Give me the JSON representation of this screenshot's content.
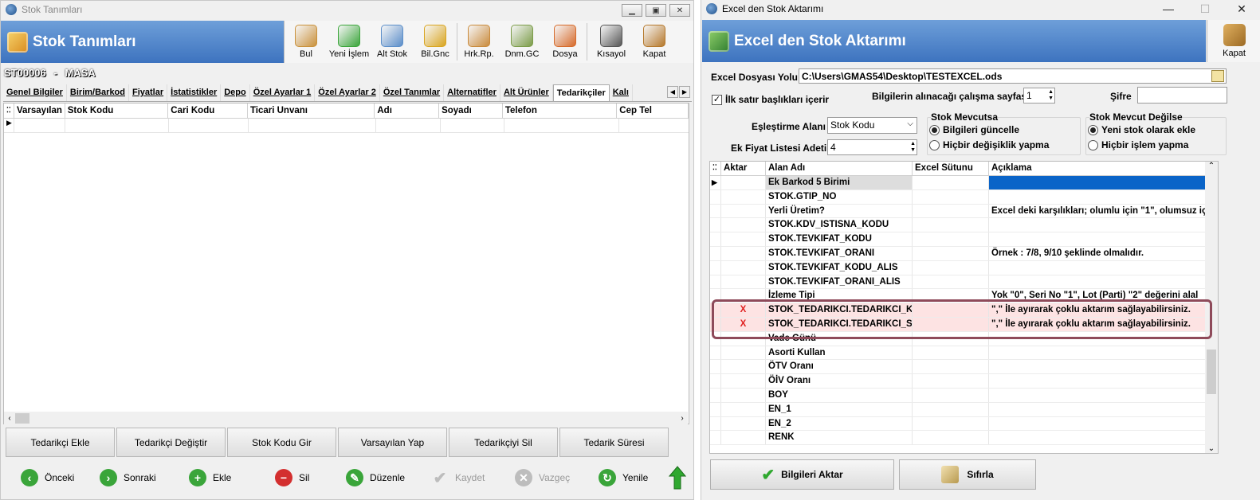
{
  "left_window": {
    "title": "Stok Tanımları",
    "banner_title": "Stok Tanımları",
    "toolbar": [
      {
        "label": "Bul",
        "icon": "find-icon",
        "color": "#c9913b"
      },
      {
        "label": "Yeni İşlem",
        "icon": "new-icon",
        "color": "#3aa53a"
      },
      {
        "label": "Alt Stok",
        "icon": "substock-icon",
        "color": "#5b8ec9"
      },
      {
        "label": "Bil.Gnc",
        "icon": "update-icon",
        "color": "#d9a520"
      },
      {
        "label": "Hrk.Rp.",
        "icon": "report-icon",
        "color": "#c98a3b"
      },
      {
        "label": "Dnm.GC",
        "icon": "period-icon",
        "color": "#7b9c48"
      },
      {
        "label": "Dosya",
        "icon": "file-icon",
        "color": "#d66a2a"
      },
      {
        "label": "Kısayol",
        "icon": "keyboard-icon",
        "color": "#555555"
      },
      {
        "label": "Kapat",
        "icon": "close-door-icon",
        "color": "#b5782b"
      }
    ],
    "record_code": "ST00006",
    "record_sep": "-",
    "record_name": "MASA",
    "tabs": [
      "Genel Bilgiler",
      "Birim/Barkod",
      "Fiyatlar",
      "İstatistikler",
      "Depo",
      "Özel Ayarlar 1",
      "Özel Ayarlar 2",
      "Özel Tanımlar",
      "Alternatifler",
      "Alt Ürünler",
      "Tedarikçiler",
      "Kalı"
    ],
    "active_tab": "Tedarikçiler",
    "grid_columns": [
      "Varsayılan",
      "Stok Kodu",
      "Cari Kodu",
      "Ticari Unvanı",
      "Adı",
      "Soyadı",
      "Telefon",
      "Cep Tel"
    ],
    "action_buttons": [
      "Tedarikçi Ekle",
      "Tedarikçi Değiştir",
      "Stok Kodu Gir",
      "Varsayılan Yap",
      "Tedarikçiyi Sil",
      "Tedarik Süresi"
    ],
    "nav_buttons": [
      {
        "label": "Önceki",
        "icon": "back-arrow-icon",
        "color": "#3aa53a",
        "enabled": true
      },
      {
        "label": "Sonraki",
        "icon": "forward-arrow-icon",
        "color": "#3aa53a",
        "enabled": true
      },
      {
        "label": "Ekle",
        "icon": "add-icon",
        "color": "#3aa53a",
        "enabled": true
      },
      {
        "label": "Sil",
        "icon": "delete-icon",
        "color": "#d32f2f",
        "enabled": true
      },
      {
        "label": "Düzenle",
        "icon": "edit-icon",
        "color": "#3aa53a",
        "enabled": true
      },
      {
        "label": "Kaydet",
        "icon": "save-check-icon",
        "color": "#bdbdbd",
        "enabled": false
      },
      {
        "label": "Vazgeç",
        "icon": "cancel-icon",
        "color": "#bdbdbd",
        "enabled": false
      },
      {
        "label": "Yenile",
        "icon": "refresh-icon",
        "color": "#3aa53a",
        "enabled": true
      }
    ]
  },
  "right_window": {
    "title": "Excel den Stok Aktarımı",
    "banner_title": "Excel den Stok Aktarımı",
    "close_label": "Kapat",
    "file_label": "Excel Dosyası Yolu",
    "file_path": "C:\\Users\\GMAS54\\Desktop\\TESTEXCEL.ods",
    "header_checkbox_label": "İlk satır başlıkları içerir",
    "sheet_label": "Bilgilerin alınacağı çalışma sayfası",
    "sheet_value": "1",
    "password_label": "Şifre",
    "password_value": "",
    "match_label": "Eşleştirme Alanı",
    "match_value": "Stok Kodu",
    "price_list_label": "Ek Fiyat Listesi Adeti",
    "price_list_value": "4",
    "exists_group": {
      "title": "Stok Mevcutsa",
      "options": [
        "Bilgileri güncelle",
        "Hiçbir değişiklik yapma"
      ],
      "selected": 0
    },
    "not_exists_group": {
      "title": "Stok Mevcut Değilse",
      "options": [
        "Yeni stok olarak ekle",
        "Hiçbir işlem yapma"
      ],
      "selected": 0
    },
    "grid_columns": [
      "Aktar",
      "Alan Adı",
      "Excel Sütunu",
      "Açıklama"
    ],
    "rows": [
      {
        "aktar": "",
        "alan": "Ek Barkod 5 Birimi",
        "excel": "",
        "aciklama": "",
        "current": true
      },
      {
        "aktar": "",
        "alan": "STOK.GTIP_NO",
        "excel": "",
        "aciklama": ""
      },
      {
        "aktar": "",
        "alan": "Yerli Üretim?",
        "excel": "",
        "aciklama": "Excel deki karşılıkları; olumlu için \"1\", olumsuz iç"
      },
      {
        "aktar": "",
        "alan": "STOK.KDV_ISTISNA_KODU",
        "excel": "",
        "aciklama": ""
      },
      {
        "aktar": "",
        "alan": "STOK.TEVKIFAT_KODU",
        "excel": "",
        "aciklama": ""
      },
      {
        "aktar": "",
        "alan": "STOK.TEVKIFAT_ORANI",
        "excel": "",
        "aciklama": "Örnek : 7/8, 9/10 şeklinde olmalıdır."
      },
      {
        "aktar": "",
        "alan": "STOK.TEVKIFAT_KODU_ALIS",
        "excel": "",
        "aciklama": ""
      },
      {
        "aktar": "",
        "alan": "STOK.TEVKIFAT_ORANI_ALIS",
        "excel": "",
        "aciklama": ""
      },
      {
        "aktar": "",
        "alan": "İzleme Tipi",
        "excel": "",
        "aciklama": "Yok \"0\", Seri No \"1\", Lot (Parti) \"2\" değerini alal"
      },
      {
        "aktar": "X",
        "alan": "STOK_TEDARIKCI.TEDARIKCI_KO",
        "excel": "",
        "aciklama": "\",\" İle ayırarak çoklu aktarım sağlayabilirsiniz.",
        "highlight": true
      },
      {
        "aktar": "X",
        "alan": "STOK_TEDARIKCI.TEDARIKCI_ST",
        "excel": "",
        "aciklama": "\",\" İle ayırarak çoklu aktarım sağlayabilirsiniz.",
        "highlight": true
      },
      {
        "aktar": "",
        "alan": "Vade Günü",
        "excel": "",
        "aciklama": ""
      },
      {
        "aktar": "",
        "alan": "Asorti Kullan",
        "excel": "",
        "aciklama": ""
      },
      {
        "aktar": "",
        "alan": "ÖTV Oranı",
        "excel": "",
        "aciklama": ""
      },
      {
        "aktar": "",
        "alan": "ÖİV Oranı",
        "excel": "",
        "aciklama": ""
      },
      {
        "aktar": "",
        "alan": "BOY",
        "excel": "",
        "aciklama": ""
      },
      {
        "aktar": "",
        "alan": "EN_1",
        "excel": "",
        "aciklama": ""
      },
      {
        "aktar": "",
        "alan": "EN_2",
        "excel": "",
        "aciklama": ""
      },
      {
        "aktar": "",
        "alan": "RENK",
        "excel": "",
        "aciklama": ""
      }
    ],
    "transfer_button": "Bilgileri Aktar",
    "reset_button": "Sıfırla",
    "colors": {
      "banner": "#4f86cc",
      "highlight": "#fde3e3",
      "highlight_border": "#8e4a5a",
      "selection": "#0a64c8",
      "x_mark": "#e02020"
    }
  }
}
